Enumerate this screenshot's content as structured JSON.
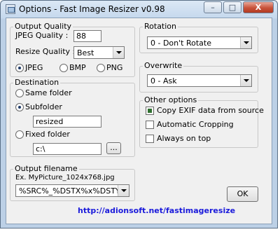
{
  "window": {
    "title": "Options - Fast Image Resizer v0.98",
    "minimize_label": "–",
    "maximize_label": "□",
    "close_label": "X"
  },
  "output_quality": {
    "title": "Output Quality",
    "jpeg_quality_label": "JPEG Quality :",
    "jpeg_quality_value": "88",
    "resize_quality_label": "Resize Quality :",
    "resize_quality_value": "Best",
    "formats": [
      {
        "label": "JPEG",
        "selected": true
      },
      {
        "label": "BMP",
        "selected": false
      },
      {
        "label": "PNG",
        "selected": false
      }
    ]
  },
  "destination": {
    "title": "Destination",
    "same_folder_label": "Same folder",
    "subfolder_label": "Subfolder",
    "subfolder_value": "resized",
    "fixed_folder_label": "Fixed folder",
    "fixed_folder_value": "c:\\",
    "browse_label": "...",
    "selected": "Subfolder"
  },
  "output_filename": {
    "title": "Output filename",
    "example": "Ex. MyPicture_1024x768.jpg",
    "pattern_value": "%SRC%_%DSTX%x%DSTY%"
  },
  "rotation": {
    "title": "Rotation",
    "value": "0 - Don't Rotate"
  },
  "overwrite": {
    "title": "Overwrite",
    "value": "0 - Ask"
  },
  "other_options": {
    "title": "Other options",
    "items": [
      {
        "label": "Copy EXIF data from source",
        "checked": true
      },
      {
        "label": "Automatic Cropping",
        "checked": false
      },
      {
        "label": "Always on top",
        "checked": false
      }
    ]
  },
  "ok_label": "OK",
  "footer_link": "http://adionsoft.net/fastimageresize",
  "colors": {
    "link": "#1a1adb",
    "window_frame": "#bcd0e6",
    "close_button": "#c8523a"
  }
}
